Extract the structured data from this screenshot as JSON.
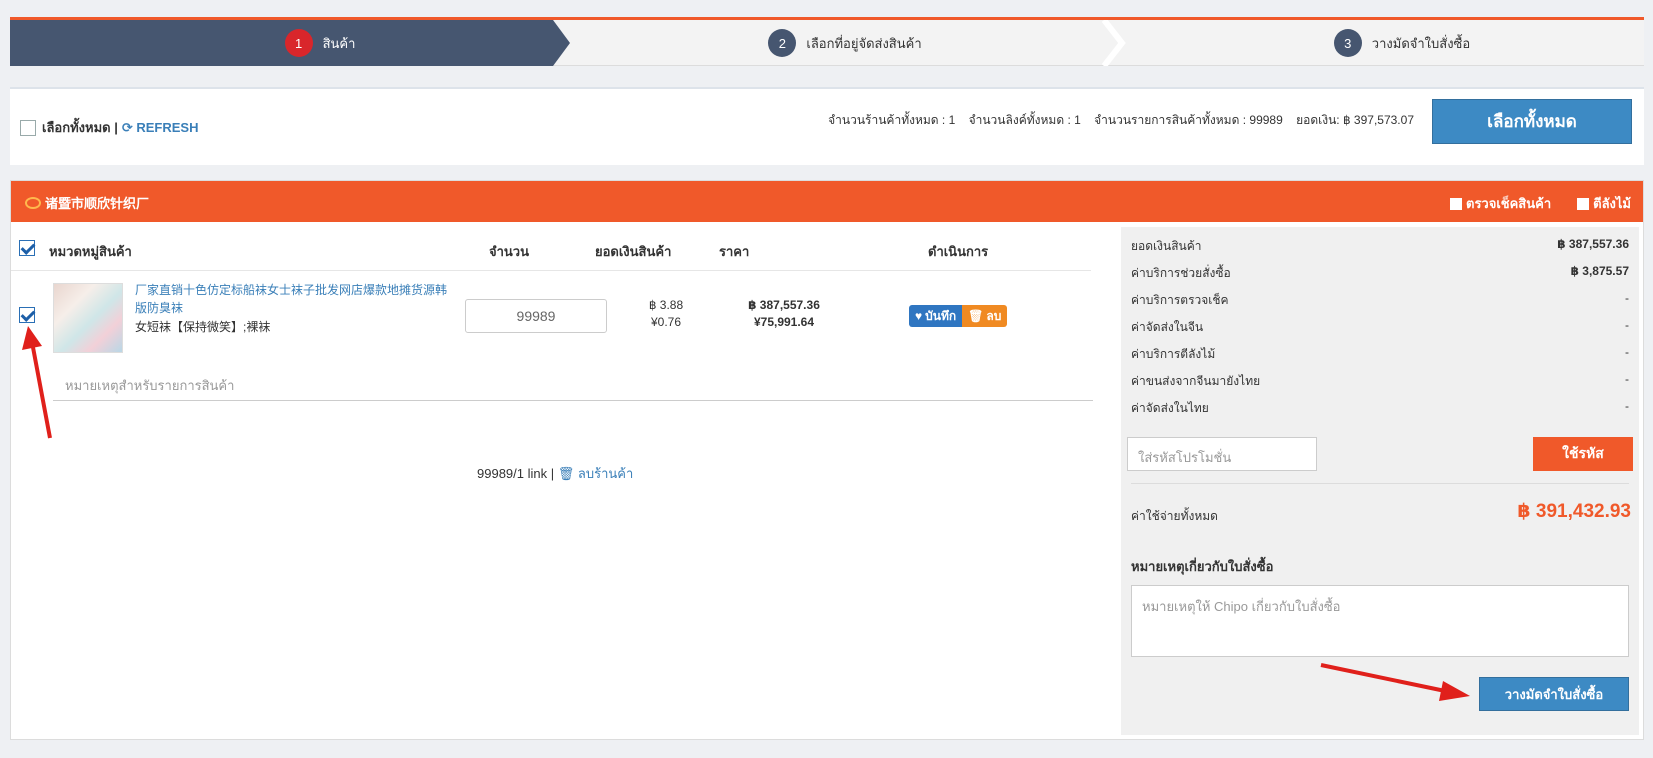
{
  "steps": [
    {
      "num": "1",
      "label": "สินค้า"
    },
    {
      "num": "2",
      "label": "เลือกที่อยู่จัดส่งสินค้า"
    },
    {
      "num": "3",
      "label": "วางมัดจำใบสั่งซื้อ"
    }
  ],
  "topbar": {
    "select_all_label": "เลือกทั้งหมด |",
    "refresh_label": "REFRESH",
    "stats": "จำนวนร้านค้าทั้งหมด : 1    จำนวนลิงค์ทั้งหมด : 1    จำนวนรายการสินค้าทั้งหมด : 99989    ยอดเงิน: ฿ 397,573.07",
    "select_all_button": "เลือกทั้งหมด"
  },
  "shop": {
    "name": "诸暨市顺欣针织厂",
    "check_goods": "ตรวจเช็คสินค้า",
    "wood_crate": "ตีลังไม้"
  },
  "columns": {
    "category": "หมวดหมู่สินค้า",
    "quantity": "จำนวน",
    "subtotal": "ยอดเงินสินค้า",
    "price": "ราคา",
    "action": "ดำเนินการ"
  },
  "item": {
    "title": "厂家直销十色仿定标船袜女士袜子批发网店爆款地摊货源韩版防臭袜",
    "variant": "女短袜【保持微笑】;裸袜",
    "quantity": "99989",
    "unit_thb": "฿ 3.88",
    "unit_cny": "¥0.76",
    "total_thb": "฿ 387,557.36",
    "total_cny": "¥75,991.64",
    "save_label": "บันทึก",
    "delete_label": "ลบ",
    "note_placeholder": "หมายเหตุสำหรับรายการสินค้า"
  },
  "shop_footer": {
    "summary": "99989/1 link |",
    "delete_shop": "ลบร้านค้า"
  },
  "summary": {
    "rows": [
      {
        "label": "ยอดเงินสินค้า",
        "value": "฿ 387,557.36"
      },
      {
        "label": "ค่าบริการช่วยสั่งซื้อ",
        "value": "฿ 3,875.57"
      },
      {
        "label": "ค่าบริการตรวจเช็ค",
        "value": "-"
      },
      {
        "label": "ค่าจัดส่งในจีน",
        "value": "-"
      },
      {
        "label": "ค่าบริการตีลังไม้",
        "value": "-"
      },
      {
        "label": "ค่าขนส่งจากจีนมายังไทย",
        "value": "-"
      },
      {
        "label": "ค่าจัดส่งในไทย",
        "value": "-"
      }
    ],
    "promo_placeholder": "ใส่รหัสโปรโมชั่น",
    "promo_button": "ใช้รหัส",
    "grand_label": "ค่าใช้จ่ายทั้งหมด",
    "grand_value": "฿ 391,432.93",
    "order_note_title": "หมายเหตุเกี่ยวกับใบสั่งซื้อ",
    "order_note_placeholder": "หมายเหตุให้ Chipo เกี่ยวกับใบสั่งซื้อ",
    "place_order_button": "วางมัดจำใบสั่งซื้อ"
  },
  "colors": {
    "accent": "#f0592a",
    "primary": "#3d8ac4",
    "step_active": "#465670"
  }
}
